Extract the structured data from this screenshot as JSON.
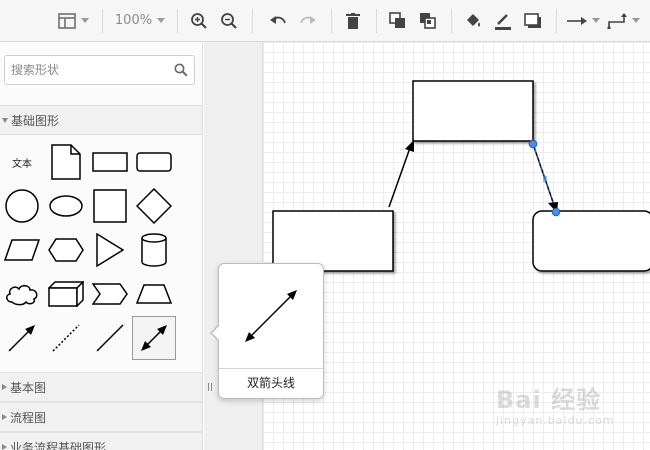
{
  "toolbar": {
    "zoom": "100%",
    "icons": [
      "panel-layout-icon",
      "zoom-in-icon",
      "zoom-out-icon",
      "undo-icon",
      "redo-icon",
      "delete-icon",
      "to-front-icon",
      "to-back-icon",
      "fill-color-icon",
      "line-color-icon",
      "shadow-icon",
      "connection-style-icon",
      "waypoint-style-icon"
    ]
  },
  "sidebar": {
    "search_placeholder": "搜索形状",
    "sections": [
      {
        "label": "基础图形",
        "expanded": true
      },
      {
        "label": "基本图",
        "expanded": false
      },
      {
        "label": "流程图",
        "expanded": false
      },
      {
        "label": "业务流程基础图形",
        "expanded": false
      }
    ],
    "text_shape_label": "文本"
  },
  "tooltip": {
    "label": "双箭头线"
  },
  "watermark": {
    "main": "Bai 经验",
    "sub": "jingyan.baidu.com"
  },
  "colors": {
    "selection": "#1a73e8",
    "stroke": "#000000",
    "grid": "#ececec"
  }
}
